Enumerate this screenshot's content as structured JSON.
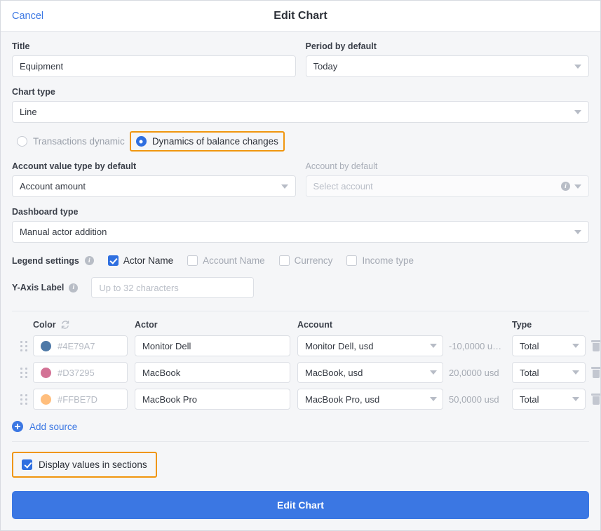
{
  "header": {
    "cancel_label": "Cancel",
    "title": "Edit Chart"
  },
  "form": {
    "title_label": "Title",
    "title_value": "Equipment",
    "period_label": "Period by default",
    "period_value": "Today",
    "chart_type_label": "Chart type",
    "chart_type_value": "Line",
    "mode_options": [
      {
        "label": "Transactions dynamic",
        "selected": false,
        "highlighted": false
      },
      {
        "label": "Dynamics of balance changes",
        "selected": true,
        "highlighted": true
      }
    ],
    "account_value_type_label": "Account value type by default",
    "account_value_type_value": "Account amount",
    "account_default_label": "Account by default",
    "account_default_placeholder": "Select account",
    "dashboard_type_label": "Dashboard type",
    "dashboard_type_value": "Manual actor addition",
    "legend_settings_label": "Legend settings",
    "legend_options": [
      {
        "label": "Actor Name",
        "checked": true
      },
      {
        "label": "Account Name",
        "checked": false
      },
      {
        "label": "Currency",
        "checked": false
      },
      {
        "label": "Income type",
        "checked": false
      }
    ],
    "yaxis_label": "Y-Axis Label",
    "yaxis_placeholder": "Up to 32 characters"
  },
  "sources_table": {
    "columns": [
      "Color",
      "Actor",
      "Account",
      "Type"
    ],
    "rows": [
      {
        "color_hex": "#4E79A7",
        "color_text": "#4E79A7",
        "actor": "Monitor Dell",
        "account": "Monitor Dell, usd",
        "amount": "-10,0000 u…",
        "type": "Total"
      },
      {
        "color_hex": "#D37295",
        "color_text": "#D37295",
        "actor": "MacBook",
        "account": "MacBook, usd",
        "amount": "20,0000 usd",
        "type": "Total"
      },
      {
        "color_hex": "#FFBE7D",
        "color_text": "#FFBE7D",
        "actor": "MacBook Pro",
        "account": "MacBook Pro, usd",
        "amount": "50,0000 usd",
        "type": "Total"
      }
    ],
    "add_source_label": "Add source"
  },
  "display_values": {
    "label": "Display values in sections",
    "checked": true,
    "highlighted": true
  },
  "footer": {
    "submit_label": "Edit Chart"
  },
  "colors": {
    "accent": "#3b77e3",
    "highlight": "#f0960f"
  }
}
